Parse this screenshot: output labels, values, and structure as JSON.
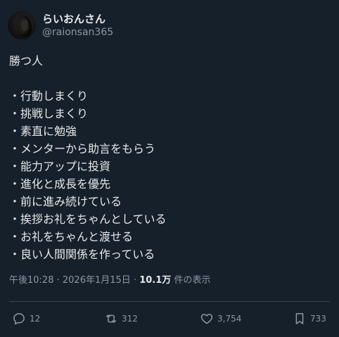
{
  "user": {
    "display_name": "らいおんさん",
    "handle": "@raionsan365"
  },
  "tweet": {
    "lines": [
      "勝つ人",
      "",
      "・行動しまくり",
      "・挑戦しまくり",
      "・素直に勉強",
      "・メンターから助言をもらう",
      "・能力アップに投資",
      "・進化と成長を優先",
      "・前に進み続けている",
      "・挨拶お礼をちゃんとしている",
      "・お礼をちゃんと渡せる",
      "・良い人間関係を作っている"
    ]
  },
  "meta": {
    "time": "午後10:28",
    "separator": "·",
    "date": "2026年1月15日",
    "views_count": "10.1万",
    "views_label": "件の表示"
  },
  "actions": {
    "reply": {
      "icon": "reply-icon",
      "count": "12"
    },
    "retweet": {
      "icon": "retweet-icon",
      "count": "312"
    },
    "like": {
      "icon": "heart-icon",
      "count": "3,754"
    },
    "bookmark": {
      "icon": "bookmark-icon",
      "count": "733"
    }
  },
  "colors": {
    "background": "#15202b",
    "text": "#e7e9ea",
    "secondary_text": "#8b98a5",
    "divider": "#38444d"
  }
}
